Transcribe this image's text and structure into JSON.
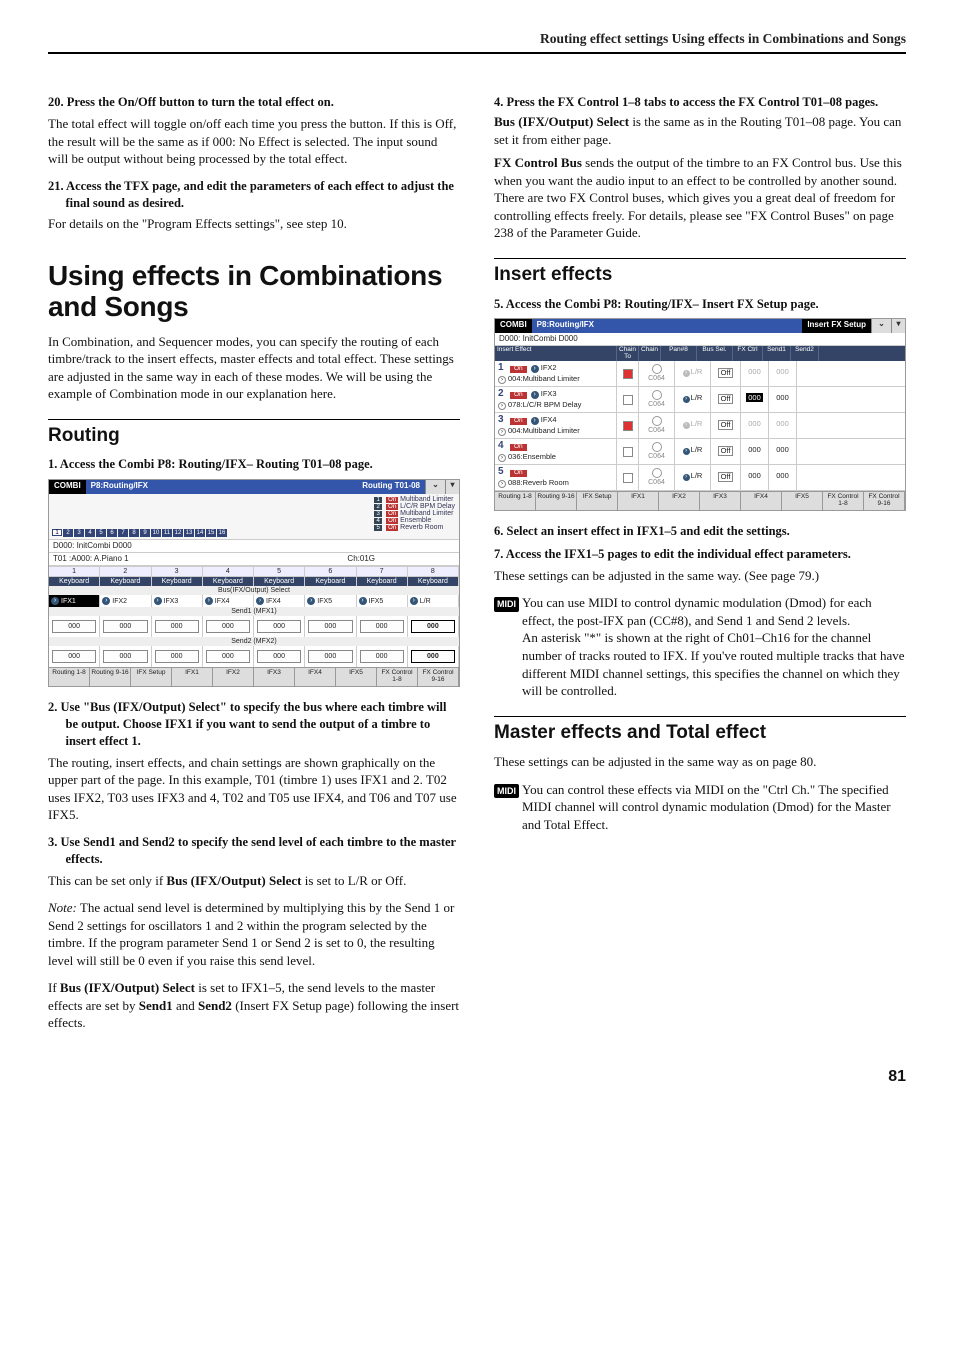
{
  "header": "Routing effect settings    Using effects in Combinations and Songs",
  "left": {
    "step20h": "20. Press the On/Off button to turn the total effect on.",
    "step20b": "The total effect will toggle on/off each time you press the button. If this is Off, the result will be the same as if 000: No Effect is selected. The input sound will be output without being processed by the total effect.",
    "step21h": "21. Access the TFX page, and edit the parameters of each effect to adjust the final sound as desired.",
    "step21b": "For details on the \"Program Effects settings\", see step 10.",
    "h1": "Using effects in Combinations and Songs",
    "intro": "In Combination, and Sequencer modes, you can specify the routing of each timbre/track to the insert effects, master effects and total effect. These settings are adjusted in the same way in each of these modes. We will be using the example of Combination mode in our explanation here.",
    "routingH": "Routing",
    "step1h": "1. Access the Combi P8: Routing/IFX– Routing T01–08 page.",
    "lcd1": {
      "tLeft": "COMBI",
      "tMid": "P8:Routing/IFX",
      "tRight": "Routing T01-08",
      "combiName": "D000: InitCombi D000",
      "timbreLine": "T01 :A000: A.Piano 1",
      "ch": "Ch:01G",
      "legend": [
        "Multiband Limiter",
        "L/C/R BPM Delay",
        "Multiband Limiter",
        "Ensemble",
        "Reverb Room"
      ],
      "kbd": "Keyboard",
      "busLbl": "Bus(IFX/Output) Select",
      "ifx": [
        "IFX1",
        "IFX2",
        "IFX3",
        "IFX4",
        "IFX4",
        "IFX5",
        "IFX5",
        "L/R"
      ],
      "send1lbl": "Send1 (MFX1)",
      "send2lbl": "Send2 (MFX2)",
      "zeros": "000",
      "tabs": [
        "Routing 1-8",
        "Routing 9-16",
        "IFX Setup",
        "IFX1",
        "IFX2",
        "IFX3",
        "IFX4",
        "IFX5",
        "FX Control 1-8",
        "FX Control 9-16"
      ]
    },
    "step2h": "2. Use \"Bus (IFX/Output) Select\" to specify the bus where each timbre will be output. Choose IFX1 if you want to send the output of a timbre to insert effect 1.",
    "step2b": "The routing, insert effects, and chain settings are shown graphically on the upper part of the page. In this example, T01 (timbre 1) uses IFX1 and 2. T02 uses IFX2, T03 uses IFX3 and 4, T02 and T05 use IFX4, and T06 and T07 use IFX5.",
    "step3h": "3. Use Send1 and Send2 to specify the send level of each timbre to the master effects.",
    "step3b1": "This can be set only if ",
    "step3b1b": "Bus (IFX/Output) Select",
    "step3b1c": " is set to L/R or Off.",
    "noteLbl": "Note:",
    "noteBody": " The actual send level is determined by multiplying this by the Send 1 or Send 2 settings for oscillators 1 and 2 within the program selected by the timbre. If the program parameter Send 1 or Send 2 is set to 0, the resulting level will still be 0 even if you raise this send level.",
    "lastp": "If Bus (IFX/Output) Select is set to IFX1–5, the send levels to the master effects are set by Send1 and Send2 (Insert FX Setup page) following the insert effects."
  },
  "right": {
    "step4h": "4. Press the FX Control 1–8 tabs to access the FX Control T01–08 pages.",
    "step4b1a": "Bus (IFX/Output) Select",
    "step4b1b": " is the same as in the Routing T01–08 page. You can set it from either page.",
    "step4b2a": "FX Control Bus",
    "step4b2b": " sends the output of the timbre to an FX Control bus. Use this when you want the audio input to an effect to be controlled by another sound. There are two FX Control buses, which gives you a great deal of freedom for controlling effects freely. For details, please see \"FX Control Buses\" on page 238 of the Parameter Guide.",
    "insertH": "Insert effects",
    "step5h": "5. Access the Combi P8: Routing/IFX– Insert FX Setup page.",
    "lcd2": {
      "tLeft": "COMBI",
      "tMid": "P8:Routing/IFX",
      "tRight": "Insert FX Setup",
      "combiName": "D000: InitCombi D000",
      "cols": [
        "Insert Effect",
        "Chain To",
        "Chain",
        "Pan#8",
        "Bus Sel.",
        "FX Ctrl",
        "Send1",
        "Send2"
      ],
      "rows": [
        {
          "n": "1",
          "chain": "IFX2",
          "name": "004:Multiband Limiter",
          "chainOn": true,
          "pan": "C064",
          "bus": "L/R",
          "busDim": true,
          "ctrl": "Off",
          "s1": "000",
          "s2": "000",
          "dim": true
        },
        {
          "n": "2",
          "chain": "IFX3",
          "name": "078:L/C/R BPM Delay",
          "chainOn": false,
          "pan": "C064",
          "bus": "L/R",
          "busDim": false,
          "ctrl": "Off",
          "s1": "000",
          "s1hi": true,
          "s2": "000",
          "dim": false
        },
        {
          "n": "3",
          "chain": "IFX4",
          "name": "004:Multiband Limiter",
          "chainOn": true,
          "pan": "C064",
          "bus": "L/R",
          "busDim": true,
          "ctrl": "Off",
          "s1": "000",
          "s2": "000",
          "dim": true
        },
        {
          "n": "4",
          "chain": "",
          "name": "036:Ensemble",
          "chainOn": false,
          "pan": "C064",
          "bus": "L/R",
          "busDim": false,
          "ctrl": "Off",
          "s1": "000",
          "s2": "000",
          "dim": false
        },
        {
          "n": "5",
          "chain": "",
          "name": "088:Reverb Room",
          "chainOn": false,
          "pan": "C064",
          "bus": "L/R",
          "busDim": false,
          "ctrl": "Off",
          "s1": "000",
          "s2": "000",
          "dim": false
        }
      ],
      "tabs": [
        "Routing 1-8",
        "Routing 9-16",
        "IFX Setup",
        "IFX1",
        "IFX2",
        "IFX3",
        "IFX4",
        "IFX5",
        "FX Control 1-8",
        "FX Control 9-16"
      ]
    },
    "step6h": "6. Select an insert effect in IFX1–5 and edit the settings.",
    "step7h": "7. Access the IFX1–5 pages to edit the individual effect parameters.",
    "step7b": "These settings can be adjusted in the same way. (See page 79.)",
    "midi1a": "You can use MIDI to control dynamic modulation (Dmod) for each effect, the post-IFX pan (CC#8), and Send 1 and Send 2 levels.",
    "midi1b": "An asterisk \"*\" is shown at the right of Ch01–Ch16 for the channel number of tracks routed to IFX. If you've routed multiple tracks that have different MIDI channel settings, this specifies the channel on which they will be controlled.",
    "masterH": "Master effects and Total effect",
    "masterB": "These settings can be adjusted in the same way as on page 80.",
    "midi2": "You can control these effects via MIDI on the \"Ctrl Ch.\" The specified MIDI channel will control dynamic modulation (Dmod) for the Master and Total Effect."
  },
  "pagenum": "81",
  "midiLabel": "MIDI"
}
